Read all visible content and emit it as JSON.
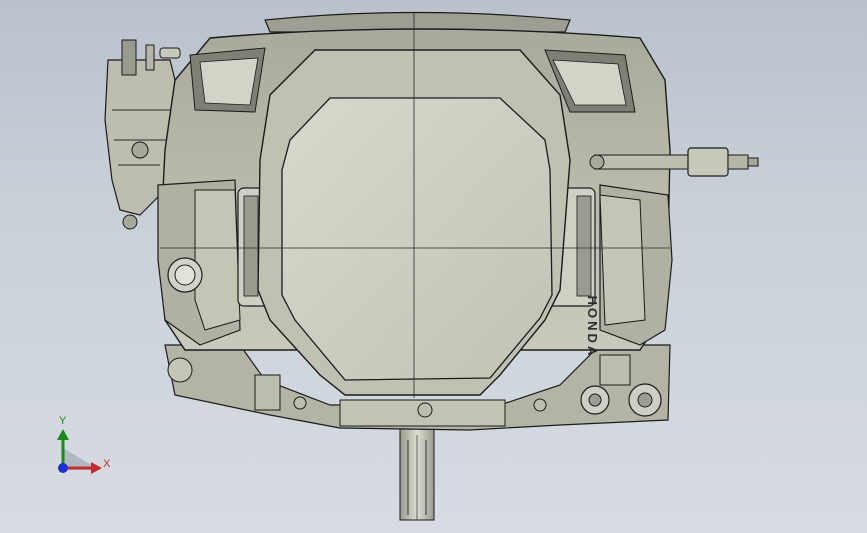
{
  "viewport": {
    "background_top": "#b9c2cc",
    "background_bottom": "#d7dce2"
  },
  "model": {
    "brand_label": "HONDA",
    "outline_color": "#1b1b1b",
    "body_color": "#b8b8aa",
    "shroud_color": "#c6c6b8",
    "panel_color": "#d2d2c6"
  },
  "triad": {
    "y_label": "Y",
    "x_label": "X",
    "y_color": "#1a8a1a",
    "x_color": "#c03030",
    "z_color": "#1f2fd0"
  }
}
